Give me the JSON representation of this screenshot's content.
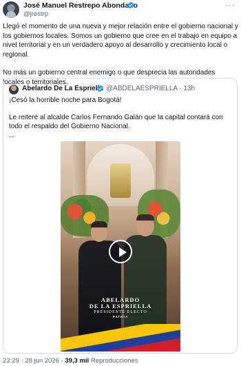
{
  "tweet": {
    "author_name": "José Manuel Restrepo Abondano",
    "author_handle": "@jrestrp",
    "more_glyph": "···",
    "paragraph1": "Llegó el momento de una nueva y mejor relación entre el gobierno nacional y los gobiernos locales. Somos un gobierno que cree en el trabajo en equipo a nivel territorial y en un verdadero apoyo al desarrollo y crecimiento local o regional.",
    "paragraph2": "No más un gobierno central enemigo o que desprecia las autoridades locales o territoriales."
  },
  "quote": {
    "author_name": "Abelardo De La Espriella",
    "author_handle": "@ABDELAESPRIELLA · 13h",
    "line1": "¡Cesó la horrible noche para Bogotá!",
    "line2": "Le reiteré al alcalde Carlos Fernando Galán que la capital contará con todo el respaldo del Gobierno Nacional.",
    "line3": "...",
    "video": {
      "overlay_name1": "ABELARDO",
      "overlay_name2": "DE LA ESPRIELLA",
      "overlay_sub": "PRESIDENTE ELECTO",
      "overlay_brand": "PATRIA"
    }
  },
  "footer": {
    "time": "23:29 · 28 jun 2026 · ",
    "views": "39,3 mil",
    "views_label": " Reproducciones"
  },
  "colors": {
    "verified_badge": "#1d9bf0",
    "secondary_text": "#536471",
    "border": "#cfd9de"
  },
  "icons": {
    "verified": "verified-badge-icon",
    "play": "play-icon",
    "more": "more-icon"
  }
}
